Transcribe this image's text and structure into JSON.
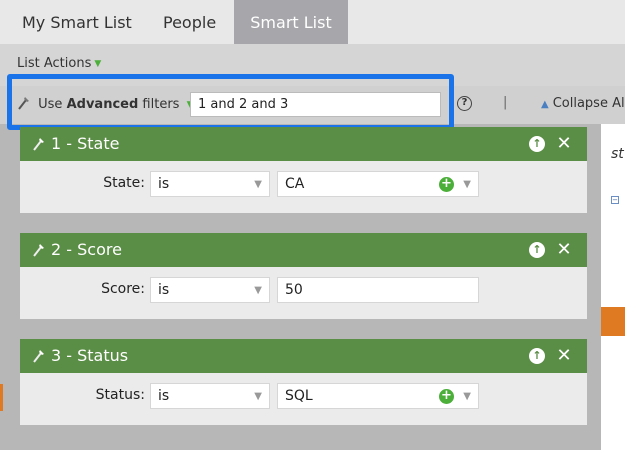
{
  "tabs": [
    {
      "label": "My Smart List",
      "active": false
    },
    {
      "label": "People",
      "active": false
    },
    {
      "label": "Smart List",
      "active": true
    }
  ],
  "toolbar": {
    "list_actions_label": "List Actions"
  },
  "advanced_filters": {
    "prefix": "Use",
    "bold": "Advanced",
    "suffix": "filters",
    "logic_value": "1 and 2 and 3"
  },
  "help_icon": "?",
  "separator": "|",
  "collapse_label": "Collapse Al",
  "right_panel": {
    "partial_text": "st"
  },
  "filters": [
    {
      "title": "1 - State",
      "field_label": "State:",
      "operator": "is",
      "value": "CA",
      "has_add": true
    },
    {
      "title": "2 - Score",
      "field_label": "Score:",
      "operator": "is",
      "value": "50",
      "has_add": false
    },
    {
      "title": "3 - Status",
      "field_label": "Status:",
      "operator": "is",
      "value": "SQL",
      "has_add": true
    }
  ],
  "colors": {
    "card_header": "#5a8d45",
    "highlight_border": "#1a73e8",
    "active_tab": "#a6a6ab",
    "add_icon": "#4caf3a",
    "accent_orange": "#e07a22"
  },
  "icons": {
    "wand": "wand-icon",
    "dropdown": "triangle-down-icon",
    "help": "help-circle-icon",
    "collapse": "triangle-up-icon",
    "move_up": "arrow-up-circle-icon",
    "remove": "close-icon",
    "add": "plus-circle-icon",
    "caret": "chevron-down-icon"
  }
}
